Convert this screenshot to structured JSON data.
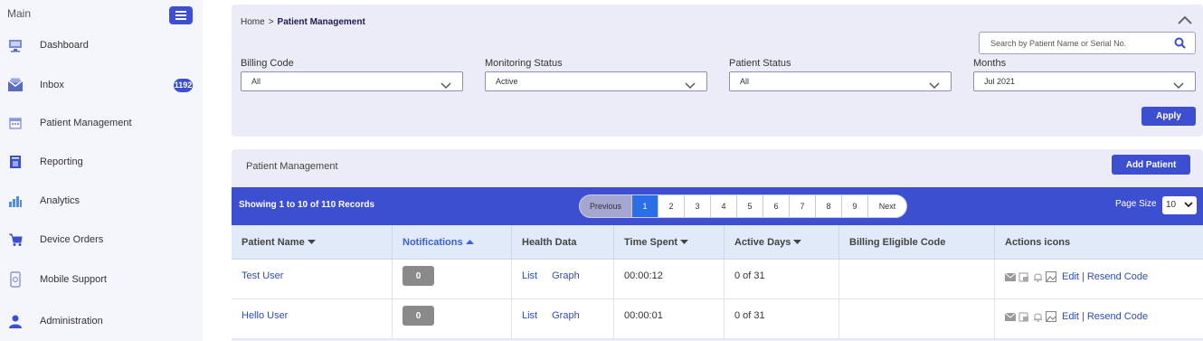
{
  "sidebar": {
    "heading": "Main",
    "items": [
      {
        "label": "Dashboard",
        "icon": "dashboard-icon"
      },
      {
        "label": "Inbox",
        "icon": "inbox-icon",
        "badge": "1192"
      },
      {
        "label": "Patient Management",
        "icon": "calendar-icon"
      },
      {
        "label": "Reporting",
        "icon": "report-icon"
      },
      {
        "label": "Analytics",
        "icon": "bar-chart-icon"
      },
      {
        "label": "Device Orders",
        "icon": "cart-icon"
      },
      {
        "label": "Mobile Support",
        "icon": "mobile-icon"
      },
      {
        "label": "Administration",
        "icon": "user-icon"
      }
    ]
  },
  "breadcrumb": {
    "home": "Home",
    "separator": ">",
    "current": "Patient Management"
  },
  "search": {
    "placeholder": "Search by Patient Name or Serial No."
  },
  "filters": [
    {
      "label": "Billing Code",
      "value": "All"
    },
    {
      "label": "Monitoring Status",
      "value": "Active"
    },
    {
      "label": "Patient Status",
      "value": "All"
    },
    {
      "label": "Months",
      "value": "Jul 2021"
    }
  ],
  "apply_label": "Apply",
  "list": {
    "title": "Patient Management",
    "add_label": "Add Patient",
    "records_text": "Showing 1 to 10 of 110 Records",
    "pager": {
      "previous": "Previous",
      "pages": [
        "1",
        "2",
        "3",
        "4",
        "5",
        "6",
        "7",
        "8",
        "9"
      ],
      "next": "Next",
      "active_page": "1"
    },
    "page_size_label": "Page Size",
    "page_size_value": "10"
  },
  "table": {
    "columns": [
      "Patient Name",
      "Notifications",
      "Health Data",
      "Time Spent",
      "Active Days",
      "Billing Eligible Code",
      "Actions icons"
    ],
    "sorted_column": "Notifications",
    "rows": [
      {
        "name": "Test User",
        "notifications": "0",
        "list": "List",
        "graph": "Graph",
        "time_spent": "00:00:12",
        "active_days": "0 of 31",
        "billing": "",
        "edit": "Edit",
        "resend": "Resend Code"
      },
      {
        "name": "Hello User",
        "notifications": "0",
        "list": "List",
        "graph": "Graph",
        "time_spent": "00:00:01",
        "active_days": "0 of 31",
        "billing": "",
        "edit": "Edit",
        "resend": "Resend Code"
      }
    ]
  },
  "colors": {
    "accent": "#3d4fd1",
    "active_page": "#2a6ee8",
    "link": "#2d4bbd",
    "sorted_header": "#3a5fe0"
  }
}
